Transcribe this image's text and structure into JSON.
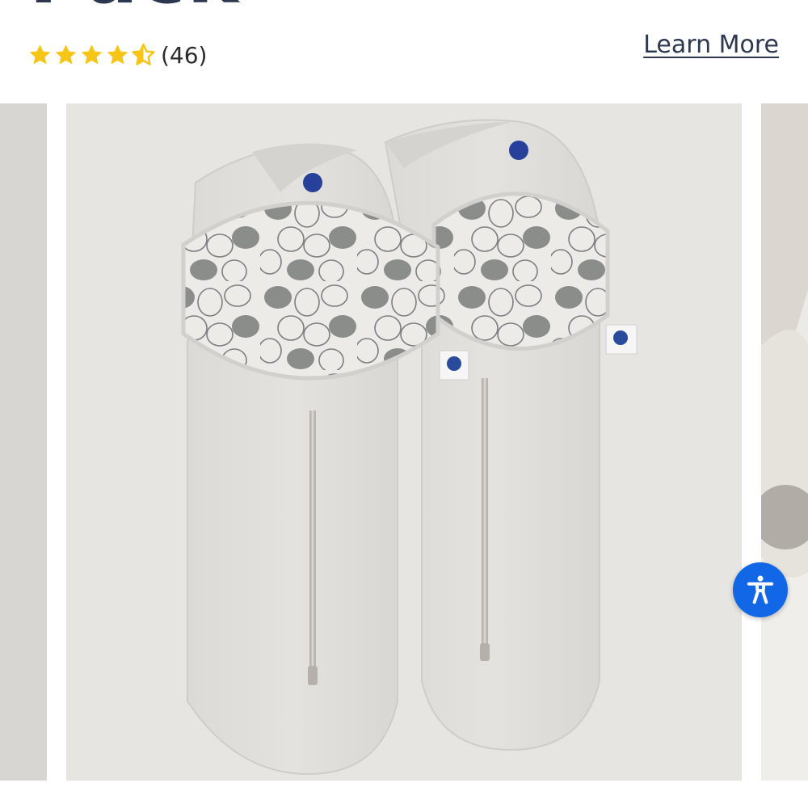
{
  "product": {
    "title_partial": "Pack",
    "rating_value": 4.5,
    "rating_max": 5,
    "review_count_label": "(46)",
    "learn_more_label": "Learn More"
  },
  "colors": {
    "title": "#2d3850",
    "star": "#f5c518",
    "accessibility_button": "#1267e6"
  },
  "gallery": {
    "image_subject": "two-swaddles-product-photo"
  },
  "accessibility": {
    "icon": "accessibility-person-icon"
  }
}
